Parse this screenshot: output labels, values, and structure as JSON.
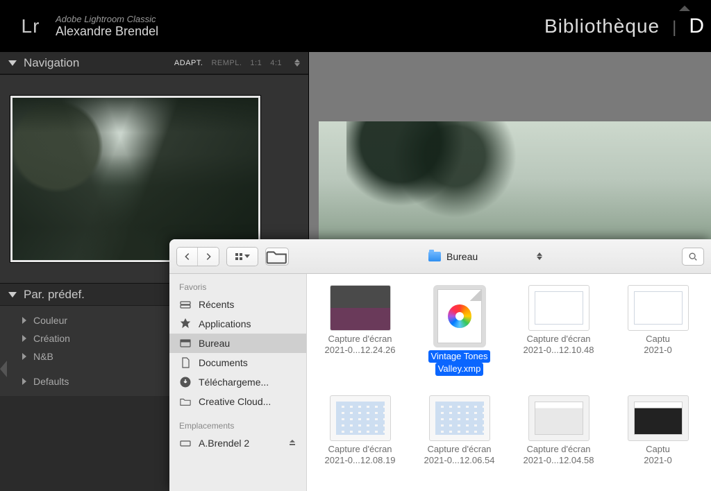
{
  "lightroom": {
    "product": "Adobe Lightroom Classic",
    "user": "Alexandre Brendel",
    "logo_text": "Lr",
    "modules": {
      "library": "Bibliothèque",
      "sep": "|",
      "develop": "D"
    },
    "nav_panel": {
      "title": "Navigation",
      "zoom": {
        "adapt": "ADAPT.",
        "rempl": "REMPL.",
        "one": "1:1",
        "four": "4:1"
      }
    },
    "preset_panel": {
      "title": "Par. prédef.",
      "items": [
        "Couleur",
        "Création",
        "N&B"
      ],
      "defaults": "Defaults"
    }
  },
  "finder": {
    "location": "Bureau",
    "sidebar": {
      "section_fav": "Favoris",
      "items": [
        {
          "icon": "recents",
          "label": "Récents"
        },
        {
          "icon": "apps",
          "label": "Applications"
        },
        {
          "icon": "desktop",
          "label": "Bureau",
          "selected": true
        },
        {
          "icon": "docs",
          "label": "Documents"
        },
        {
          "icon": "dl",
          "label": "Téléchargeme..."
        },
        {
          "icon": "folder",
          "label": "Creative Cloud..."
        }
      ],
      "section_loc": "Emplacements",
      "drive": "A.Brendel 2"
    },
    "files": {
      "row1": [
        {
          "name_l1": "Capture d'écran",
          "name_l2": "2021-0...12.24.26",
          "kind": "shot1"
        },
        {
          "name_l1": "Vintage Tones",
          "name_l2": "Valley.xmp",
          "kind": "xmp",
          "selected": true
        },
        {
          "name_l1": "Capture d'écran",
          "name_l2": "2021-0...12.10.48",
          "kind": "win"
        },
        {
          "name_l1": "Captu",
          "name_l2": "2021-0",
          "kind": "win"
        }
      ],
      "row2": [
        {
          "name_l1": "Capture d'écran",
          "name_l2": "2021-0...12.08.19",
          "kind": "grid"
        },
        {
          "name_l1": "Capture d'écran",
          "name_l2": "2021-0...12.06.54",
          "kind": "grid"
        },
        {
          "name_l1": "Capture d'écran",
          "name_l2": "2021-0...12.04.58",
          "kind": "app"
        },
        {
          "name_l1": "Captu",
          "name_l2": "2021-0",
          "kind": "dark"
        }
      ]
    }
  }
}
